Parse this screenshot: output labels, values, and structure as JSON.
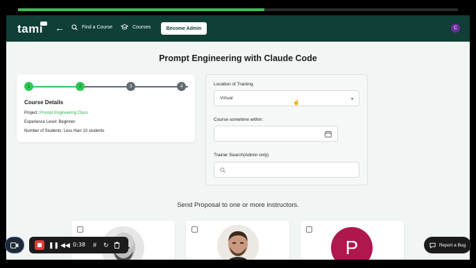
{
  "video": {
    "progress_percent": 56
  },
  "nav": {
    "logo": "tami",
    "find_course": "Find a Course",
    "courses": "Courses",
    "become_admin": "Become Admin",
    "avatar_initial": "C"
  },
  "page": {
    "title": "Prompt Engineering with Claude Code"
  },
  "steps": [
    {
      "label": "1",
      "state": "done"
    },
    {
      "label": "2",
      "state": "done"
    },
    {
      "label": "3",
      "state": "todo"
    },
    {
      "label": "4",
      "state": "todo"
    }
  ],
  "course_details": {
    "heading": "Course Details",
    "project_label": "Project:",
    "project_value": "Prompt Engineering Class",
    "experience": "Experience Level: Beginner",
    "students": "Number of Students: Less than 10 students"
  },
  "form": {
    "location_label": "Location of Training",
    "location_value": "Virtual",
    "sometime_label": "Course sometime within:",
    "trainer_label": "Trainer Search(Admin only)"
  },
  "proposal": {
    "text": "Send Proposal to one or more instructors."
  },
  "instructors": [
    {
      "type": "photo"
    },
    {
      "type": "photo"
    },
    {
      "type": "initial",
      "initial": "P"
    }
  ],
  "recorder": {
    "time": "0:38"
  },
  "report_bug": {
    "label": "Report a Bug"
  },
  "colors": {
    "nav": "#0f3f36",
    "accent_green": "#2fc655",
    "avatar_p": "#b0174f"
  },
  "icons": [
    "back-arrow-icon",
    "search-icon",
    "graduation-cap-icon",
    "chevron-down-icon",
    "calendar-icon",
    "camera-icon",
    "stop-icon",
    "pause-icon",
    "rewind-icon",
    "grid-icon",
    "restart-icon",
    "trash-icon",
    "bug-icon"
  ]
}
